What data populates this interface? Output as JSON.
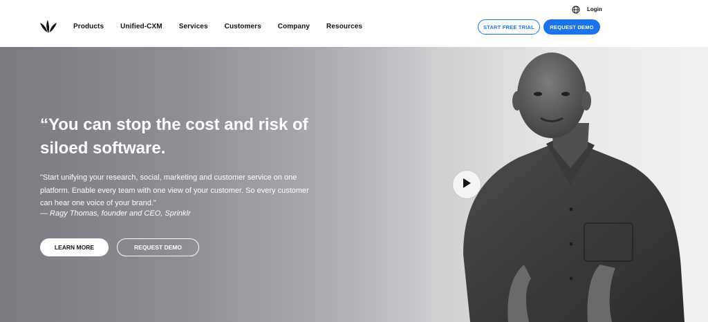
{
  "header": {
    "login_label": "Login",
    "nav": [
      {
        "label": "Products"
      },
      {
        "label": "Unified-CXM"
      },
      {
        "label": "Services"
      },
      {
        "label": "Customers"
      },
      {
        "label": "Company"
      },
      {
        "label": "Resources"
      }
    ],
    "trial_label": "START FREE TRIAL",
    "demo_label": "REQUEST DEMO"
  },
  "hero": {
    "headline": "“You can stop the cost and risk of siloed software.",
    "quote": "\"Start unifying your research, social, marketing and customer service on one platform. Enable every team with one view of your customer. So every customer can hear one voice of your brand.\"",
    "attribution": "— Ragy Thomas, founder and CEO, Sprinklr",
    "learn_more_label": "LEARN MORE",
    "request_demo_label": "REQUEST DEMO"
  },
  "colors": {
    "accent": "#1a73e8",
    "hero_text": "#ffffff"
  },
  "icons": {
    "logo": "sprinklr-logo",
    "globe": "globe-icon",
    "play": "play-icon"
  }
}
